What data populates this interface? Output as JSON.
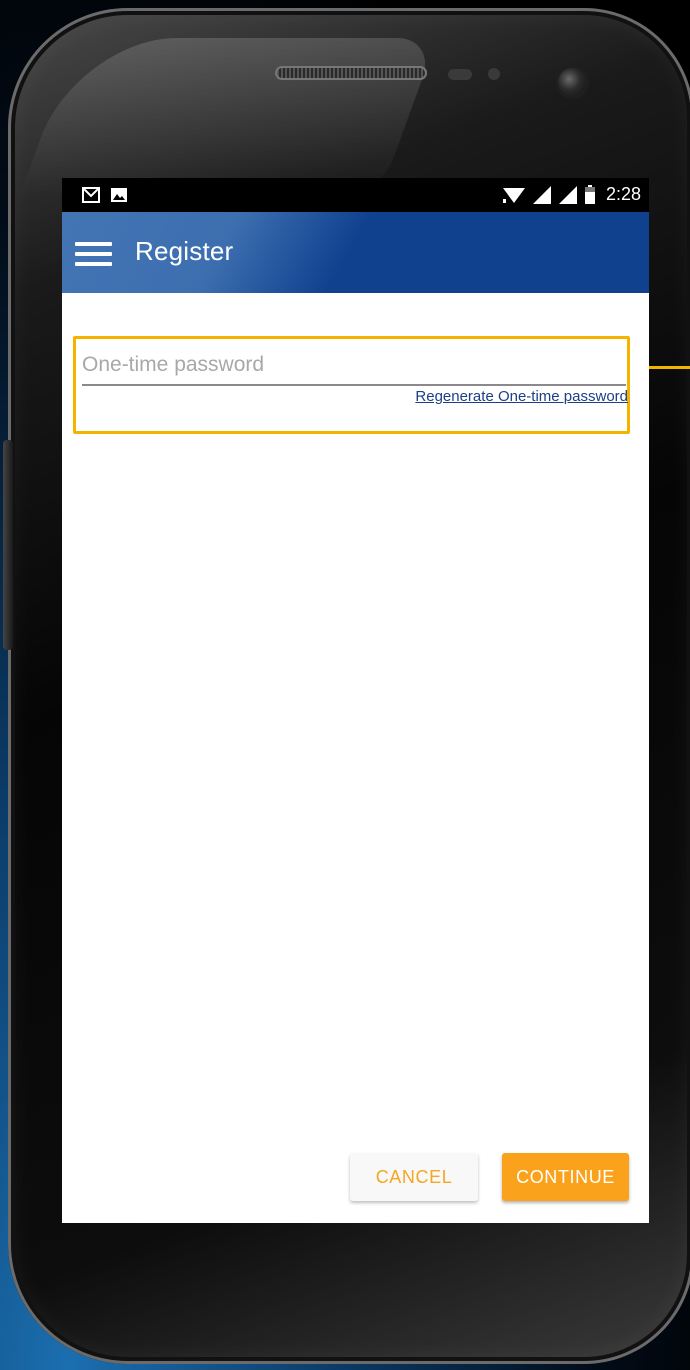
{
  "status_bar": {
    "time": "2:28",
    "left_icons": [
      "gmail-icon",
      "image-icon"
    ],
    "right_icons": [
      "wifi-icon",
      "signal-icon",
      "signal-icon",
      "battery-icon"
    ]
  },
  "app_bar": {
    "menu_icon": "hamburger-menu-icon",
    "title": "Register",
    "color": "#10418f"
  },
  "form": {
    "otp_placeholder": "One-time password",
    "otp_value": "",
    "regenerate_link": "Regenerate One-time password",
    "highlight_color": "#f5b300"
  },
  "actions": {
    "cancel_label": "CANCEL",
    "continue_label": "CONTINUE",
    "accent_color": "#fba21c"
  }
}
